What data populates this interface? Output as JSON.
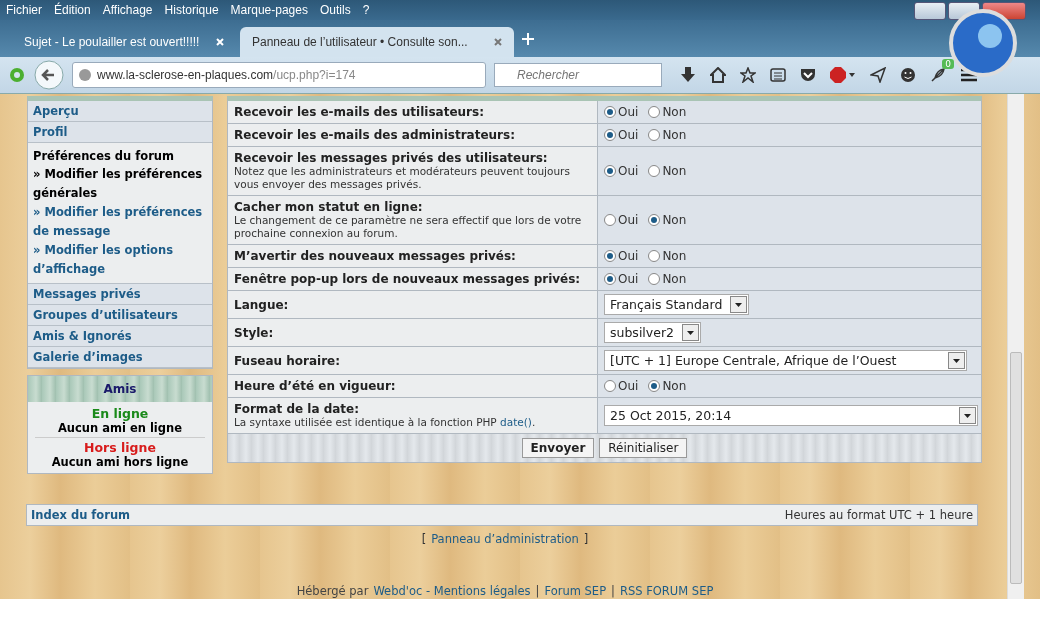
{
  "menu": [
    "Fichier",
    "Édition",
    "Affichage",
    "Historique",
    "Marque-pages",
    "Outils",
    "?"
  ],
  "tabs": [
    {
      "label": "Sujet - Le poulailler est ouvert!!!!!",
      "selected": false
    },
    {
      "label": "Panneau de l’utilisateur • Consulte son...",
      "selected": true
    }
  ],
  "address": {
    "host": "www.la-sclerose-en-plaques.com",
    "path": "/ucp.php?i=174"
  },
  "search": {
    "placeholder": "Rechercher"
  },
  "toolbar_badge": "0",
  "sidebar": [
    {
      "kind": "link",
      "label": "Aperçu"
    },
    {
      "kind": "link",
      "label": "Profil"
    },
    {
      "kind": "section",
      "label": "Préférences du forum",
      "children": [
        {
          "label": "» Modifier les préférences générales",
          "selected": true
        },
        {
          "label": "» Modifier les préférences de message",
          "selected": false
        },
        {
          "label": "» Modifier les options d’affichage",
          "selected": false
        }
      ]
    },
    {
      "kind": "link",
      "label": "Messages privés"
    },
    {
      "kind": "link",
      "label": "Groupes d’utilisateurs"
    },
    {
      "kind": "link",
      "label": "Amis & Ignorés"
    },
    {
      "kind": "link",
      "label": "Galerie d’images"
    }
  ],
  "friends": {
    "title": "Amis",
    "online_label": "En ligne",
    "online_text": "Aucun ami en ligne",
    "offline_label": "Hors ligne",
    "offline_text": "Aucun ami hors ligne"
  },
  "settings": [
    {
      "label": "Recevoir les e-mails des utilisateurs:",
      "kind": "radio",
      "options": [
        {
          "label": "Oui",
          "selected": true
        },
        {
          "label": "Non",
          "selected": false
        }
      ]
    },
    {
      "label": "Recevoir les e-mails des administrateurs:",
      "kind": "radio",
      "options": [
        {
          "label": "Oui",
          "selected": true
        },
        {
          "label": "Non",
          "selected": false
        }
      ]
    },
    {
      "label": "Recevoir les messages privés des utilisateurs:",
      "note": "Notez que les administrateurs et modérateurs peuvent toujours vous envoyer des messages privés.",
      "kind": "radio",
      "options": [
        {
          "label": "Oui",
          "selected": true
        },
        {
          "label": "Non",
          "selected": false
        }
      ]
    },
    {
      "label": "Cacher mon statut en ligne:",
      "note": "Le changement de ce paramètre ne sera effectif que lors de votre prochaine connexion au forum.",
      "kind": "radio",
      "options": [
        {
          "label": "Oui",
          "selected": false
        },
        {
          "label": "Non",
          "selected": true
        }
      ]
    },
    {
      "label": "M’avertir des nouveaux messages privés:",
      "kind": "radio",
      "options": [
        {
          "label": "Oui",
          "selected": true
        },
        {
          "label": "Non",
          "selected": false
        }
      ]
    },
    {
      "label": "Fenêtre pop-up lors de nouveaux messages privés:",
      "kind": "radio",
      "options": [
        {
          "label": "Oui",
          "selected": true
        },
        {
          "label": "Non",
          "selected": false
        }
      ]
    },
    {
      "label": "Langue:",
      "kind": "select",
      "value": "Français Standard"
    },
    {
      "label": "Style:",
      "kind": "select",
      "value": "subsilver2"
    },
    {
      "label": "Fuseau horaire:",
      "kind": "wide_select",
      "value": "[UTC + 1] Europe Centrale, Afrique de l’Ouest"
    },
    {
      "label": "Heure d’été en vigueur:",
      "kind": "radio",
      "options": [
        {
          "label": "Oui",
          "selected": false
        },
        {
          "label": "Non",
          "selected": true
        }
      ]
    },
    {
      "label": "Format de la date:",
      "note": "La syntaxe utilisée est identique à la fonction PHP ",
      "note_link": "date()",
      "note_end": ".",
      "kind": "full_select",
      "value": "25 Oct 2015, 20:14"
    }
  ],
  "buttons": [
    {
      "label": "Envoyer",
      "kind": "primary"
    },
    {
      "label": "Réinitialiser",
      "kind": "secondary"
    }
  ],
  "footer": {
    "nav_link": "Index du forum",
    "timezone": "Heures au format UTC + 1 heure"
  },
  "admin": {
    "open": "[",
    "link": "Panneau d’administration",
    "close": "]"
  },
  "hosted": [
    {
      "kind": "text",
      "text": "Hébergé par"
    },
    {
      "kind": "link",
      "text": "Webd'oc - Mentions légales"
    },
    {
      "kind": "text",
      "text": "|"
    },
    {
      "kind": "link",
      "text": "Forum SEP"
    },
    {
      "kind": "text",
      "text": "|"
    },
    {
      "kind": "link",
      "text": "RSS FORUM SEP"
    }
  ]
}
